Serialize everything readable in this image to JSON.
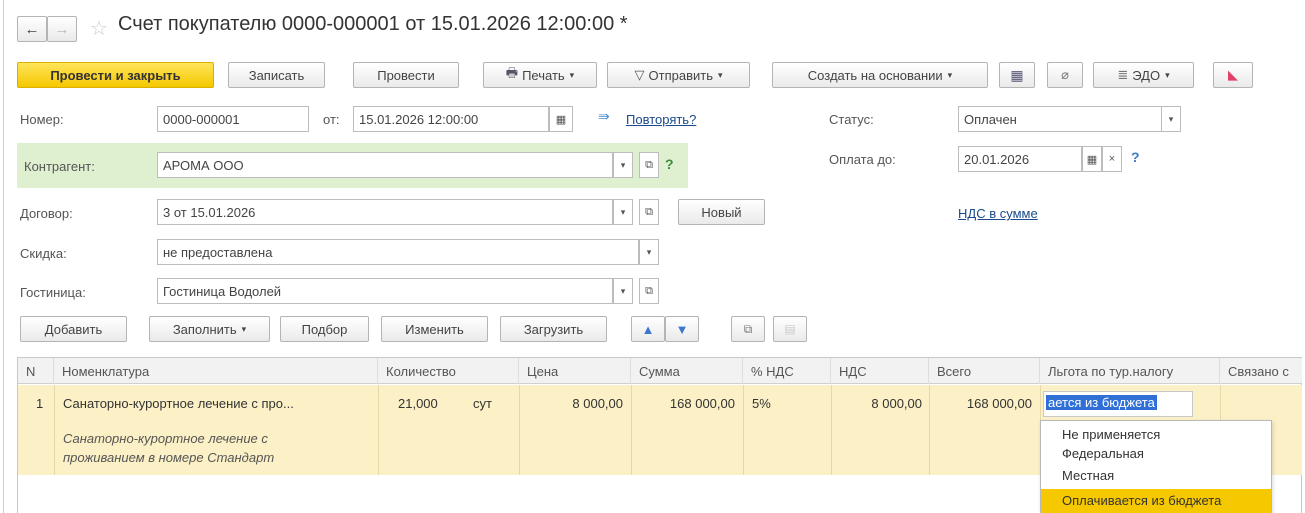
{
  "title": "Счет покупателю 0000-000001 от 15.01.2026 12:00:00 *",
  "toolbar": {
    "post_close": "Провести и закрыть",
    "save": "Записать",
    "post": "Провести",
    "print": "Печать",
    "send": "Отправить",
    "create_based": "Создать на основании",
    "edo": "ЭДО"
  },
  "form": {
    "number_label": "Номер:",
    "number_value": "0000-000001",
    "date_label": "от:",
    "date_value": "15.01.2026 12:00:00",
    "repeat_link": "Повторять?",
    "status_label": "Статус:",
    "status_value": "Оплачен",
    "counterparty_label": "Контрагент:",
    "counterparty_value": "АРОМА ООО",
    "pay_until_label": "Оплата до:",
    "pay_until_value": "20.01.2026",
    "contract_label": "Договор:",
    "contract_value": "3 от 15.01.2026",
    "new_button": "Новый",
    "vat_link": "НДС в сумме",
    "discount_label": "Скидка:",
    "discount_value": "не предоставлена",
    "hotel_label": "Гостиница:",
    "hotel_value": "Гостиница Водолей",
    "help": "?"
  },
  "table_toolbar": {
    "add": "Добавить",
    "fill": "Заполнить",
    "select": "Подбор",
    "change": "Изменить",
    "load": "Загрузить"
  },
  "table": {
    "headers": [
      "N",
      "Номенклатура",
      "Количество",
      "Цена",
      "Сумма",
      "% НДС",
      "НДС",
      "Всего",
      "Льгота по тур.налогу",
      "Связано с"
    ],
    "row": {
      "n": "1",
      "item": "Санаторно-курортное лечение с про...",
      "item_desc_1": "Санаторно-курортное лечение с",
      "item_desc_2": "проживанием в номере Стандарт",
      "qty": "21,000",
      "unit": "сут",
      "price": "8 000,00",
      "sum": "168 000,00",
      "vat_rate": "5%",
      "vat": "8 000,00",
      "total": "168 000,00",
      "benefit_edit": "ается из бюджета"
    },
    "dropdown_options": [
      "Не применяется",
      "Федеральная",
      "Местная",
      "Оплачивается из бюджета"
    ]
  },
  "colors": {
    "primary": "#f5c800",
    "row_highlight": "#fbf0c6",
    "selection": "#2f6fd6",
    "green_bg": "#dff0d0"
  }
}
